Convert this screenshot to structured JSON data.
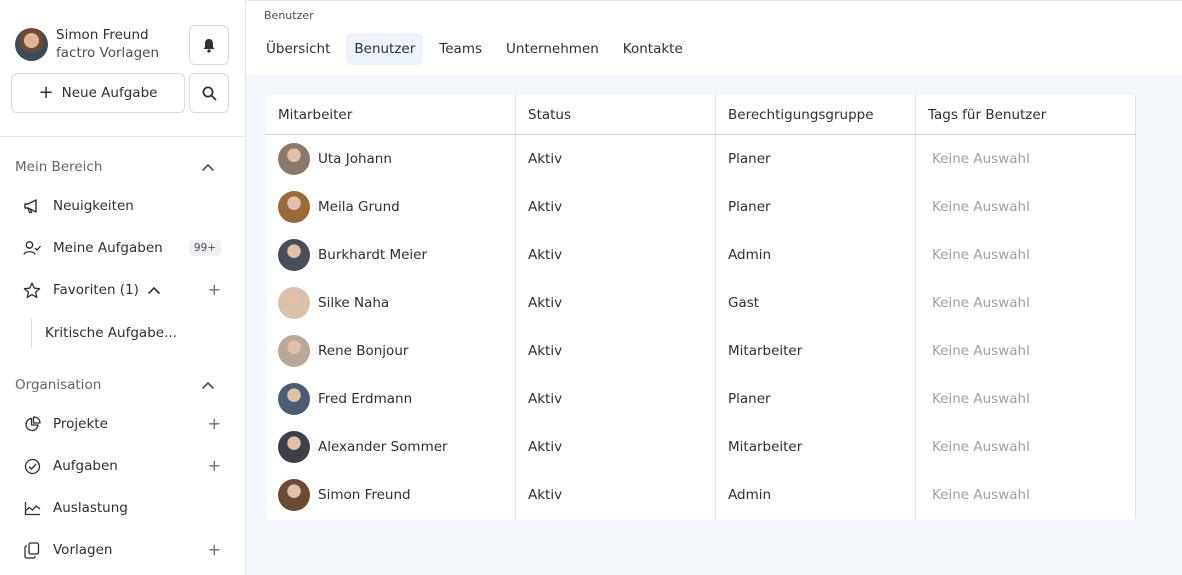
{
  "profile": {
    "name": "Simon Freund",
    "org": "factro Vorlagen"
  },
  "actions": {
    "new_task_label": "Neue Aufgabe"
  },
  "sections": {
    "mein_bereich": "Mein Bereich",
    "organisation": "Organisation"
  },
  "nav": {
    "neuigkeiten": "Neuigkeiten",
    "meine_aufgaben": "Meine Aufgaben",
    "meine_aufgaben_badge": "99+",
    "favoriten": "Favoriten (1)",
    "kritische": "Kritische Aufgabe...",
    "projekte": "Projekte",
    "aufgaben": "Aufgaben",
    "auslastung": "Auslastung",
    "vorlagen": "Vorlagen"
  },
  "breadcrumb": "Benutzer",
  "tabs": [
    "Übersicht",
    "Benutzer",
    "Teams",
    "Unternehmen",
    "Kontakte"
  ],
  "table": {
    "headers": [
      "Mitarbeiter",
      "Status",
      "Berechtigungsgruppe",
      "Tags für Benutzer"
    ],
    "rows": [
      {
        "name": "Uta Johann",
        "status": "Aktiv",
        "group": "Planer",
        "tags": "Keine Auswahl",
        "avatar_color": "#8a7a6e"
      },
      {
        "name": "Meila Grund",
        "status": "Aktiv",
        "group": "Planer",
        "tags": "Keine Auswahl",
        "avatar_color": "#9a6a3c"
      },
      {
        "name": "Burkhardt Meier",
        "status": "Aktiv",
        "group": "Admin",
        "tags": "Keine Auswahl",
        "avatar_color": "#4a4e58"
      },
      {
        "name": "Silke Naha",
        "status": "Aktiv",
        "group": "Gast",
        "tags": "Keine Auswahl",
        "avatar_color": "#d9c2ac"
      },
      {
        "name": "Rene Bonjour",
        "status": "Aktiv",
        "group": "Mitarbeiter",
        "tags": "Keine Auswahl",
        "avatar_color": "#b7a89a"
      },
      {
        "name": "Fred Erdmann",
        "status": "Aktiv",
        "group": "Planer",
        "tags": "Keine Auswahl",
        "avatar_color": "#4c5c72"
      },
      {
        "name": "Alexander Sommer",
        "status": "Aktiv",
        "group": "Mitarbeiter",
        "tags": "Keine Auswahl",
        "avatar_color": "#3d4048"
      },
      {
        "name": "Simon Freund",
        "status": "Aktiv",
        "group": "Admin",
        "tags": "Keine Auswahl",
        "avatar_color": "#6b4a36"
      }
    ]
  }
}
